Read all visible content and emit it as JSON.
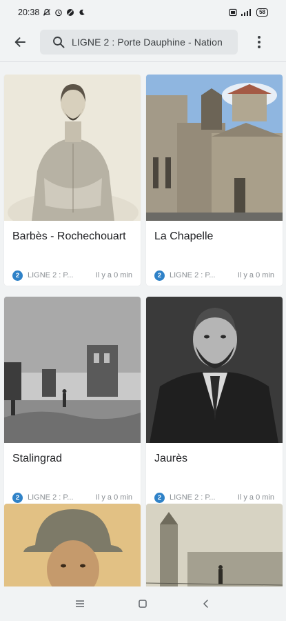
{
  "status_bar": {
    "time": "20:38",
    "battery": "58"
  },
  "search": {
    "query": "LIGNE 2 : Porte Dauphine - Nation"
  },
  "cards": [
    {
      "title": "Barbès - Rochechouart",
      "line": "2",
      "line_label": "LIGNE 2 : P...",
      "time": "Il y a 0 min"
    },
    {
      "title": "La Chapelle",
      "line": "2",
      "line_label": "LIGNE 2 : P...",
      "time": "Il y a 0 min"
    },
    {
      "title": "Stalingrad",
      "line": "2",
      "line_label": "LIGNE 2 : P...",
      "time": "Il y a 0 min"
    },
    {
      "title": "Jaurès",
      "line": "2",
      "line_label": "LIGNE 2 : P...",
      "time": "Il y a 0 min"
    },
    {
      "title": "",
      "line": "",
      "line_label": "",
      "time": ""
    },
    {
      "title": "",
      "line": "",
      "line_label": "",
      "time": ""
    }
  ],
  "colors": {
    "line_badge": "#2f82c8",
    "background": "#f1f3f4"
  }
}
